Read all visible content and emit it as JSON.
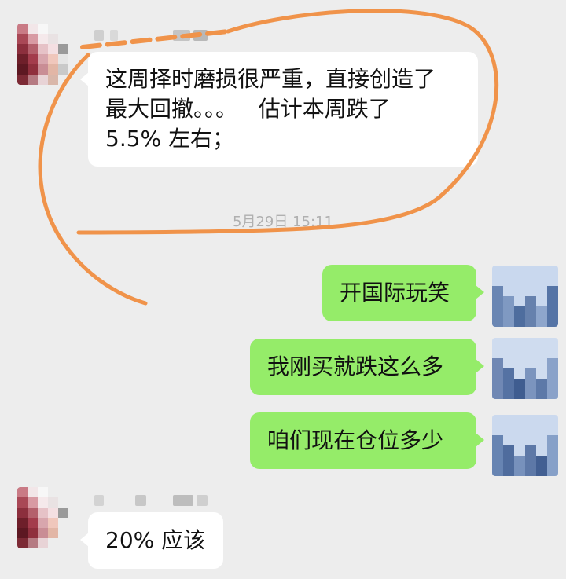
{
  "messages": [
    {
      "id": "m1",
      "direction": "incoming",
      "lines": [
        "这周择时磨损很严重，直接创造了",
        "最大回撤。。。   估计本周跌了",
        "5.5% 左右；"
      ]
    },
    {
      "id": "m2",
      "direction": "outgoing",
      "text": "开国际玩笑"
    },
    {
      "id": "m3",
      "direction": "outgoing",
      "text": "我刚买就跌这么多"
    },
    {
      "id": "m4",
      "direction": "outgoing",
      "text": "咱们现在仓位多少"
    },
    {
      "id": "m5",
      "direction": "incoming",
      "text": "20% 应该"
    }
  ],
  "timestamp": "5月29日 15:11",
  "colors": {
    "background": "#ededed",
    "incoming_bubble": "#ffffff",
    "outgoing_bubble": "#95ec69",
    "annotation_stroke": "#f0934a"
  },
  "icons": {
    "contact_avatar": "avatar-icon",
    "self_avatar": "avatar-icon"
  }
}
